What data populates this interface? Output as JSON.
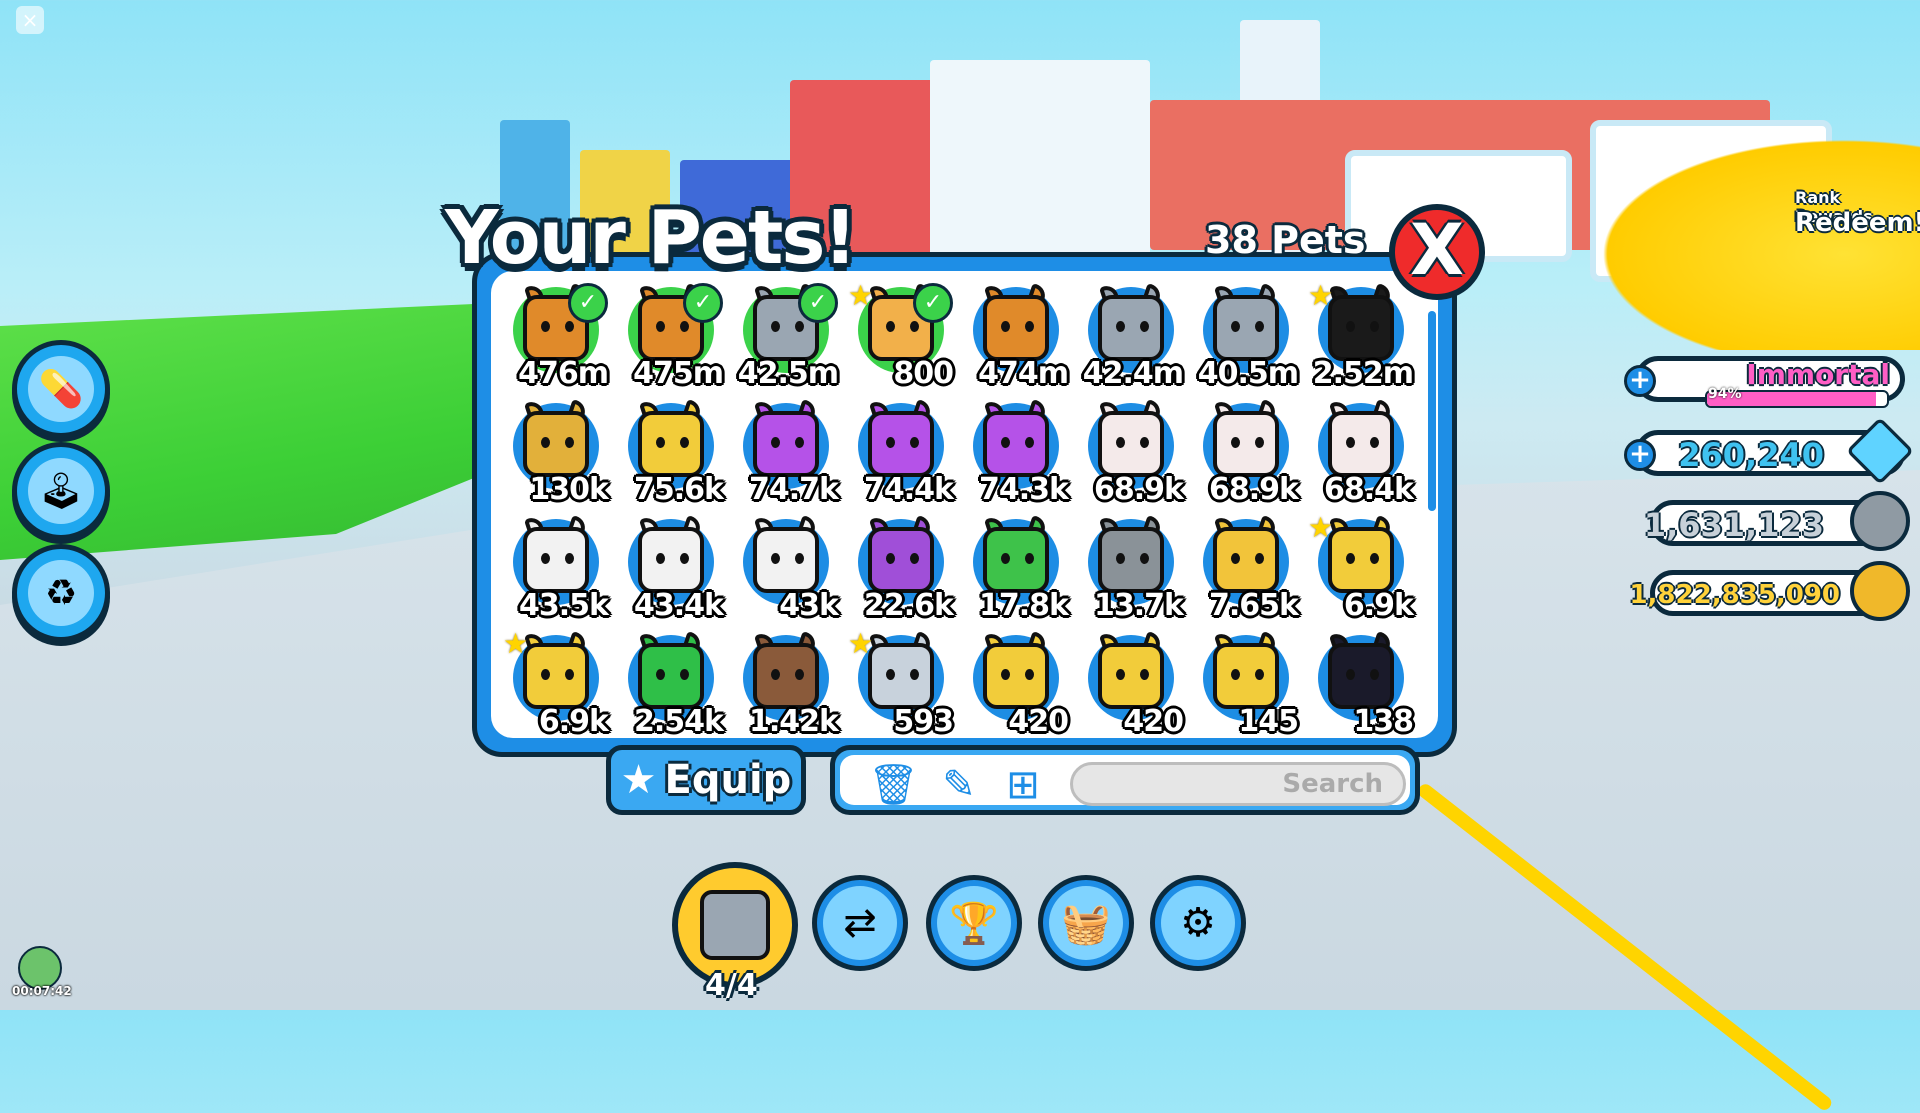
{
  "header": {
    "title": "Your Pets!",
    "pet_count": "38 Pets",
    "close_label": "X"
  },
  "pets": [
    {
      "value": "476m",
      "color": "#e08a2a",
      "equipped": true,
      "star": false
    },
    {
      "value": "475m",
      "color": "#e08a2a",
      "equipped": true,
      "star": false
    },
    {
      "value": "42.5m",
      "color": "#9aa6b2",
      "equipped": true,
      "star": false
    },
    {
      "value": "800",
      "color": "#f2b04a",
      "equipped": true,
      "star": true
    },
    {
      "value": "474m",
      "color": "#e08a2a",
      "equipped": false,
      "star": false
    },
    {
      "value": "42.4m",
      "color": "#9aa6b2",
      "equipped": false,
      "star": false
    },
    {
      "value": "40.5m",
      "color": "#9aa6b2",
      "equipped": false,
      "star": false
    },
    {
      "value": "2.52m",
      "color": "#1a1a1a",
      "equipped": false,
      "star": true
    },
    {
      "value": "130k",
      "color": "#e2b03a",
      "equipped": false,
      "star": false
    },
    {
      "value": "75.6k",
      "color": "#f2cc3a",
      "equipped": false,
      "star": false
    },
    {
      "value": "74.7k",
      "color": "#b552e8",
      "equipped": false,
      "star": false
    },
    {
      "value": "74.4k",
      "color": "#b552e8",
      "equipped": false,
      "star": false
    },
    {
      "value": "74.3k",
      "color": "#b552e8",
      "equipped": false,
      "star": false
    },
    {
      "value": "68.9k",
      "color": "#f4eaea",
      "equipped": false,
      "star": false
    },
    {
      "value": "68.9k",
      "color": "#f4eaea",
      "equipped": false,
      "star": false
    },
    {
      "value": "68.4k",
      "color": "#f4eaea",
      "equipped": false,
      "star": false
    },
    {
      "value": "43.5k",
      "color": "#f2f2f2",
      "equipped": false,
      "star": false
    },
    {
      "value": "43.4k",
      "color": "#f2f2f2",
      "equipped": false,
      "star": false
    },
    {
      "value": "43k",
      "color": "#f2f2f2",
      "equipped": false,
      "star": false
    },
    {
      "value": "22.6k",
      "color": "#a04fd8",
      "equipped": false,
      "star": false
    },
    {
      "value": "17.8k",
      "color": "#3ec24a",
      "equipped": false,
      "star": false
    },
    {
      "value": "13.7k",
      "color": "#8a9298",
      "equipped": false,
      "star": false
    },
    {
      "value": "7.65k",
      "color": "#f2c43a",
      "equipped": false,
      "star": false
    },
    {
      "value": "6.9k",
      "color": "#f2cc3a",
      "equipped": false,
      "star": true
    },
    {
      "value": "6.9k",
      "color": "#f2cc3a",
      "equipped": false,
      "star": true
    },
    {
      "value": "2.54k",
      "color": "#2fbf48",
      "equipped": false,
      "star": false
    },
    {
      "value": "1.42k",
      "color": "#8a5a3a",
      "equipped": false,
      "star": false
    },
    {
      "value": "593",
      "color": "#c8d2dc",
      "equipped": false,
      "star": true
    },
    {
      "value": "420",
      "color": "#f2cc3a",
      "equipped": false,
      "star": false
    },
    {
      "value": "420",
      "color": "#f2cc3a",
      "equipped": false,
      "star": false
    },
    {
      "value": "145",
      "color": "#f2cc3a",
      "equipped": false,
      "star": false
    },
    {
      "value": "138",
      "color": "#1a1a2a",
      "equipped": false,
      "star": false
    }
  ],
  "actions": {
    "equip_label": "Equip",
    "search_placeholder": "Search"
  },
  "rank": {
    "name": "Immortal",
    "progress_label": "94%",
    "progress": 0.94,
    "rewards_label": "Rank Rewards",
    "redeem_label": "Redeem!"
  },
  "currencies": {
    "diamonds": "260,240",
    "tech_coins": "1,631,123",
    "coins": "1,822,835,090"
  },
  "bottom_bar": {
    "equipped_count": "4/4"
  },
  "misc": {
    "timer": "00:07:42"
  },
  "colors": {
    "accent": "#1e8ee6",
    "outline": "#0b2a3d",
    "close": "#ef2b2b",
    "equip_green": "#3bd24a"
  }
}
